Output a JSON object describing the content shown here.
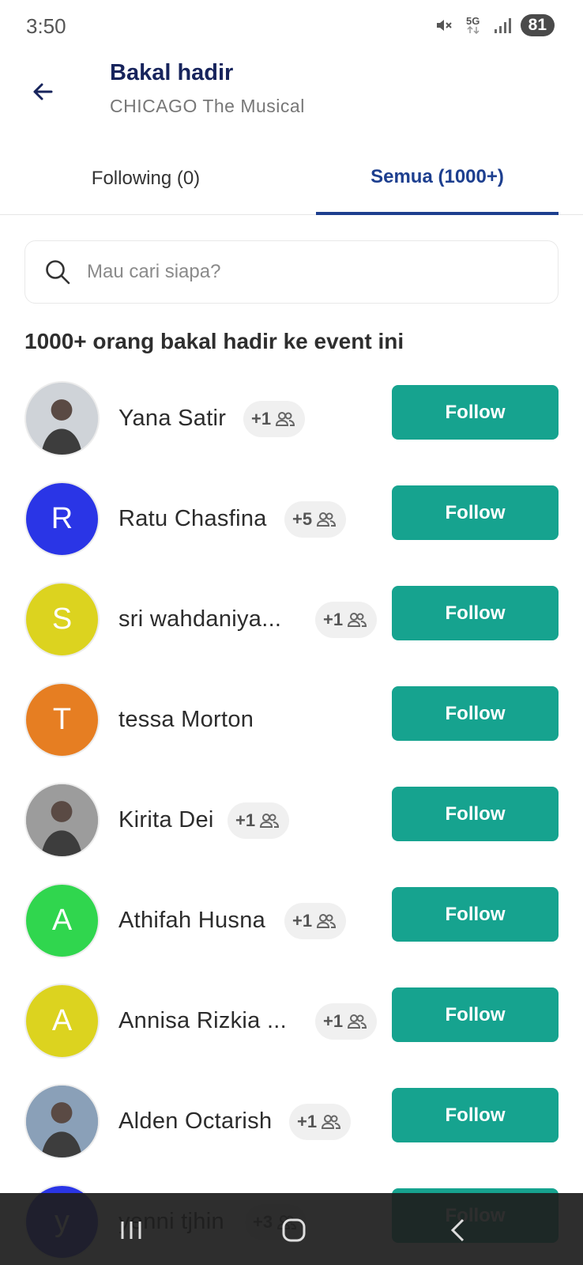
{
  "status_bar": {
    "time": "3:50",
    "network": "5G",
    "battery": "81",
    "icons": [
      "mute-icon",
      "5g-icon",
      "signal-icon",
      "battery-icon"
    ]
  },
  "header": {
    "title": "Bakal hadir",
    "subtitle": "CHICAGO The Musical"
  },
  "tabs": [
    {
      "label": "Following (0)",
      "active": false
    },
    {
      "label": "Semua (1000+)",
      "active": true
    }
  ],
  "search": {
    "placeholder": "Mau cari siapa?",
    "value": ""
  },
  "count_heading": "1000+ orang bakal hadir ke event ini",
  "follow_label": "Follow",
  "people": [
    {
      "name": "Yana Satir",
      "initial": "",
      "badge": "+1",
      "avatar_color": "#cfd3d8",
      "photo": true
    },
    {
      "name": "Ratu Chasfina",
      "initial": "R",
      "badge": "+5",
      "avatar_color": "#2a35e6"
    },
    {
      "name": "sri wahdaniya...",
      "initial": "S",
      "badge": "+1",
      "avatar_color": "#dcd31f"
    },
    {
      "name": "tessa Morton",
      "initial": "T",
      "badge": "",
      "avatar_color": "#e67e22"
    },
    {
      "name": "Kirita Dei",
      "initial": "",
      "badge": "+1",
      "avatar_color": "#9c9c9c",
      "photo": true
    },
    {
      "name": "Athifah Husna",
      "initial": "A",
      "badge": "+1",
      "avatar_color": "#30d64e"
    },
    {
      "name": "Annisa Rizkia ...",
      "initial": "A",
      "badge": "+1",
      "avatar_color": "#dcd31f"
    },
    {
      "name": "Alden Octarish",
      "initial": "",
      "badge": "+1",
      "avatar_color": "#8aa0b8",
      "photo": true
    },
    {
      "name": "yenni tjhin",
      "initial": "y",
      "badge": "+3",
      "avatar_color": "#2a35e6"
    }
  ],
  "colors": {
    "accent": "#1d3f8f",
    "follow_button": "#16a38f",
    "title": "#17245c"
  },
  "nav_bar": {
    "icons": [
      "recent-apps-icon",
      "home-icon",
      "back-icon"
    ]
  }
}
